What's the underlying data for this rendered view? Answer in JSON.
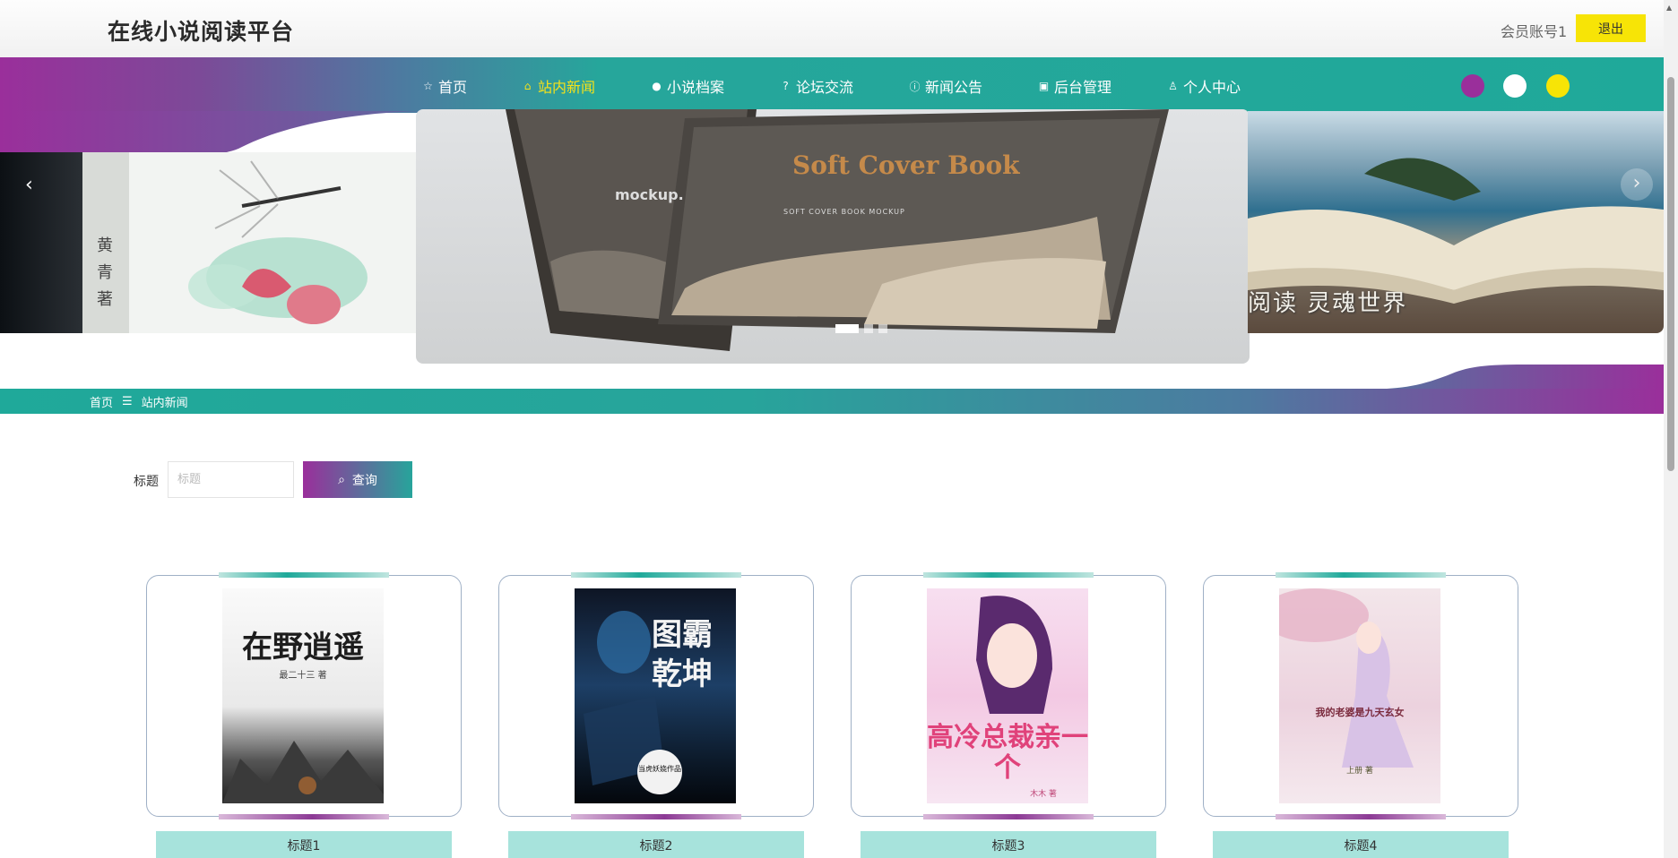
{
  "header": {
    "site_title": "在线小说阅读平台",
    "member_label": "会员账号1",
    "logout_label": "退出"
  },
  "nav": {
    "items": [
      {
        "label": "首页",
        "icon": "star-icon"
      },
      {
        "label": "站内新闻",
        "icon": "bag-icon",
        "active": true
      },
      {
        "label": "小说档案",
        "icon": "info-icon"
      },
      {
        "label": "论坛交流",
        "icon": "question-icon"
      },
      {
        "label": "新闻公告",
        "icon": "info-circle-icon"
      },
      {
        "label": "后台管理",
        "icon": "gift-icon"
      },
      {
        "label": "个人中心",
        "icon": "user-icon"
      }
    ],
    "theme_colors": [
      "#9a2f9b",
      "#ffffff",
      "#f7e406"
    ],
    "active_color": "#f5e21a"
  },
  "banner": {
    "left_slide_text": "黄 青 著",
    "center_title": "Soft Cover Book",
    "center_subtitle": "SOFT COVER BOOK MOCKUP",
    "center_mockup": "mockup.",
    "right_caption": "阅读 灵魂世界",
    "prev_arrow": "‹",
    "next_arrow": "›",
    "slide_count": 3,
    "active_slide": 1
  },
  "breadcrumb": {
    "home": "首页",
    "separator": "☰",
    "current": "站内新闻"
  },
  "search": {
    "label": "标题",
    "placeholder": "标题",
    "button_label": "查询"
  },
  "cards": [
    {
      "title": "标题1",
      "cover_text": "在野逍遥",
      "cover_sub": "最二十三 著"
    },
    {
      "title": "标题2",
      "cover_text": "图霸乾坤",
      "cover_sub": "当虎妖娆作品"
    },
    {
      "title": "标题3",
      "cover_text": "高冷总裁亲一个",
      "cover_sub": "木木 著"
    },
    {
      "title": "标题4",
      "cover_text": "我的老婆是九天玄女",
      "cover_sub": "上册 著"
    }
  ]
}
